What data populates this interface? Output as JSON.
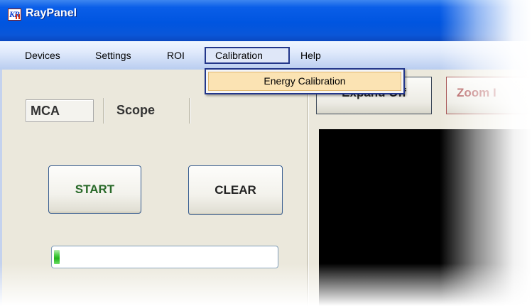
{
  "window": {
    "title": "RayPanel",
    "icon": "raypanel-app-icon",
    "icon_glyph": "KR"
  },
  "menubar": {
    "items": [
      "Devices",
      "Settings",
      "ROI",
      "Calibration",
      "Help"
    ],
    "open_menu": "Calibration"
  },
  "calibration_menu": {
    "items": [
      "Energy Calibration"
    ],
    "highlighted": "Energy Calibration"
  },
  "left_panel": {
    "tabs": [
      "MCA",
      "Scope"
    ],
    "active_tab": "MCA",
    "start_label": "START",
    "clear_label": "CLEAR",
    "progress_fraction": 0.025
  },
  "right_panel": {
    "expand_label": "Expand Off",
    "zoom_label": "Zoom I"
  },
  "colors": {
    "titlebar": "#0055e0",
    "menu_highlight": "#fbe3b3",
    "client_bg": "#ebe8dc",
    "start_text": "#2a6a2a",
    "zoom_text": "#a84646",
    "plot_bg": "#000000",
    "progress_fill": "#21b21b"
  }
}
